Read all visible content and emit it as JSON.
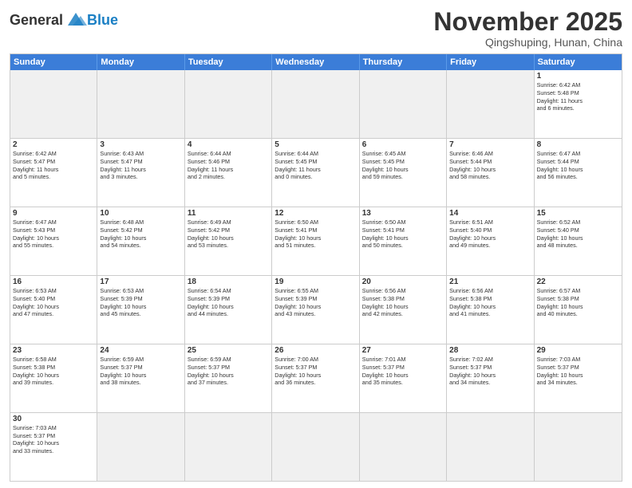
{
  "header": {
    "logo_general": "General",
    "logo_blue": "Blue",
    "month_title": "November 2025",
    "subtitle": "Qingshuping, Hunan, China"
  },
  "weekdays": [
    "Sunday",
    "Monday",
    "Tuesday",
    "Wednesday",
    "Thursday",
    "Friday",
    "Saturday"
  ],
  "rows": [
    [
      {
        "day": "",
        "empty": true,
        "content": ""
      },
      {
        "day": "",
        "empty": true,
        "content": ""
      },
      {
        "day": "",
        "empty": true,
        "content": ""
      },
      {
        "day": "",
        "empty": true,
        "content": ""
      },
      {
        "day": "",
        "empty": true,
        "content": ""
      },
      {
        "day": "",
        "empty": true,
        "content": ""
      },
      {
        "day": "1",
        "empty": false,
        "content": "Sunrise: 6:42 AM\nSunset: 5:48 PM\nDaylight: 11 hours\nand 6 minutes."
      }
    ],
    [
      {
        "day": "2",
        "empty": false,
        "content": "Sunrise: 6:42 AM\nSunset: 5:47 PM\nDaylight: 11 hours\nand 5 minutes."
      },
      {
        "day": "3",
        "empty": false,
        "content": "Sunrise: 6:43 AM\nSunset: 5:47 PM\nDaylight: 11 hours\nand 3 minutes."
      },
      {
        "day": "4",
        "empty": false,
        "content": "Sunrise: 6:44 AM\nSunset: 5:46 PM\nDaylight: 11 hours\nand 2 minutes."
      },
      {
        "day": "5",
        "empty": false,
        "content": "Sunrise: 6:44 AM\nSunset: 5:45 PM\nDaylight: 11 hours\nand 0 minutes."
      },
      {
        "day": "6",
        "empty": false,
        "content": "Sunrise: 6:45 AM\nSunset: 5:45 PM\nDaylight: 10 hours\nand 59 minutes."
      },
      {
        "day": "7",
        "empty": false,
        "content": "Sunrise: 6:46 AM\nSunset: 5:44 PM\nDaylight: 10 hours\nand 58 minutes."
      },
      {
        "day": "8",
        "empty": false,
        "content": "Sunrise: 6:47 AM\nSunset: 5:44 PM\nDaylight: 10 hours\nand 56 minutes."
      }
    ],
    [
      {
        "day": "9",
        "empty": false,
        "content": "Sunrise: 6:47 AM\nSunset: 5:43 PM\nDaylight: 10 hours\nand 55 minutes."
      },
      {
        "day": "10",
        "empty": false,
        "content": "Sunrise: 6:48 AM\nSunset: 5:42 PM\nDaylight: 10 hours\nand 54 minutes."
      },
      {
        "day": "11",
        "empty": false,
        "content": "Sunrise: 6:49 AM\nSunset: 5:42 PM\nDaylight: 10 hours\nand 53 minutes."
      },
      {
        "day": "12",
        "empty": false,
        "content": "Sunrise: 6:50 AM\nSunset: 5:41 PM\nDaylight: 10 hours\nand 51 minutes."
      },
      {
        "day": "13",
        "empty": false,
        "content": "Sunrise: 6:50 AM\nSunset: 5:41 PM\nDaylight: 10 hours\nand 50 minutes."
      },
      {
        "day": "14",
        "empty": false,
        "content": "Sunrise: 6:51 AM\nSunset: 5:40 PM\nDaylight: 10 hours\nand 49 minutes."
      },
      {
        "day": "15",
        "empty": false,
        "content": "Sunrise: 6:52 AM\nSunset: 5:40 PM\nDaylight: 10 hours\nand 48 minutes."
      }
    ],
    [
      {
        "day": "16",
        "empty": false,
        "content": "Sunrise: 6:53 AM\nSunset: 5:40 PM\nDaylight: 10 hours\nand 47 minutes."
      },
      {
        "day": "17",
        "empty": false,
        "content": "Sunrise: 6:53 AM\nSunset: 5:39 PM\nDaylight: 10 hours\nand 45 minutes."
      },
      {
        "day": "18",
        "empty": false,
        "content": "Sunrise: 6:54 AM\nSunset: 5:39 PM\nDaylight: 10 hours\nand 44 minutes."
      },
      {
        "day": "19",
        "empty": false,
        "content": "Sunrise: 6:55 AM\nSunset: 5:39 PM\nDaylight: 10 hours\nand 43 minutes."
      },
      {
        "day": "20",
        "empty": false,
        "content": "Sunrise: 6:56 AM\nSunset: 5:38 PM\nDaylight: 10 hours\nand 42 minutes."
      },
      {
        "day": "21",
        "empty": false,
        "content": "Sunrise: 6:56 AM\nSunset: 5:38 PM\nDaylight: 10 hours\nand 41 minutes."
      },
      {
        "day": "22",
        "empty": false,
        "content": "Sunrise: 6:57 AM\nSunset: 5:38 PM\nDaylight: 10 hours\nand 40 minutes."
      }
    ],
    [
      {
        "day": "23",
        "empty": false,
        "content": "Sunrise: 6:58 AM\nSunset: 5:38 PM\nDaylight: 10 hours\nand 39 minutes."
      },
      {
        "day": "24",
        "empty": false,
        "content": "Sunrise: 6:59 AM\nSunset: 5:37 PM\nDaylight: 10 hours\nand 38 minutes."
      },
      {
        "day": "25",
        "empty": false,
        "content": "Sunrise: 6:59 AM\nSunset: 5:37 PM\nDaylight: 10 hours\nand 37 minutes."
      },
      {
        "day": "26",
        "empty": false,
        "content": "Sunrise: 7:00 AM\nSunset: 5:37 PM\nDaylight: 10 hours\nand 36 minutes."
      },
      {
        "day": "27",
        "empty": false,
        "content": "Sunrise: 7:01 AM\nSunset: 5:37 PM\nDaylight: 10 hours\nand 35 minutes."
      },
      {
        "day": "28",
        "empty": false,
        "content": "Sunrise: 7:02 AM\nSunset: 5:37 PM\nDaylight: 10 hours\nand 34 minutes."
      },
      {
        "day": "29",
        "empty": false,
        "content": "Sunrise: 7:03 AM\nSunset: 5:37 PM\nDaylight: 10 hours\nand 34 minutes."
      }
    ],
    [
      {
        "day": "30",
        "empty": false,
        "content": "Sunrise: 7:03 AM\nSunset: 5:37 PM\nDaylight: 10 hours\nand 33 minutes."
      },
      {
        "day": "",
        "empty": true,
        "content": ""
      },
      {
        "day": "",
        "empty": true,
        "content": ""
      },
      {
        "day": "",
        "empty": true,
        "content": ""
      },
      {
        "day": "",
        "empty": true,
        "content": ""
      },
      {
        "day": "",
        "empty": true,
        "content": ""
      },
      {
        "day": "",
        "empty": true,
        "content": ""
      }
    ]
  ]
}
